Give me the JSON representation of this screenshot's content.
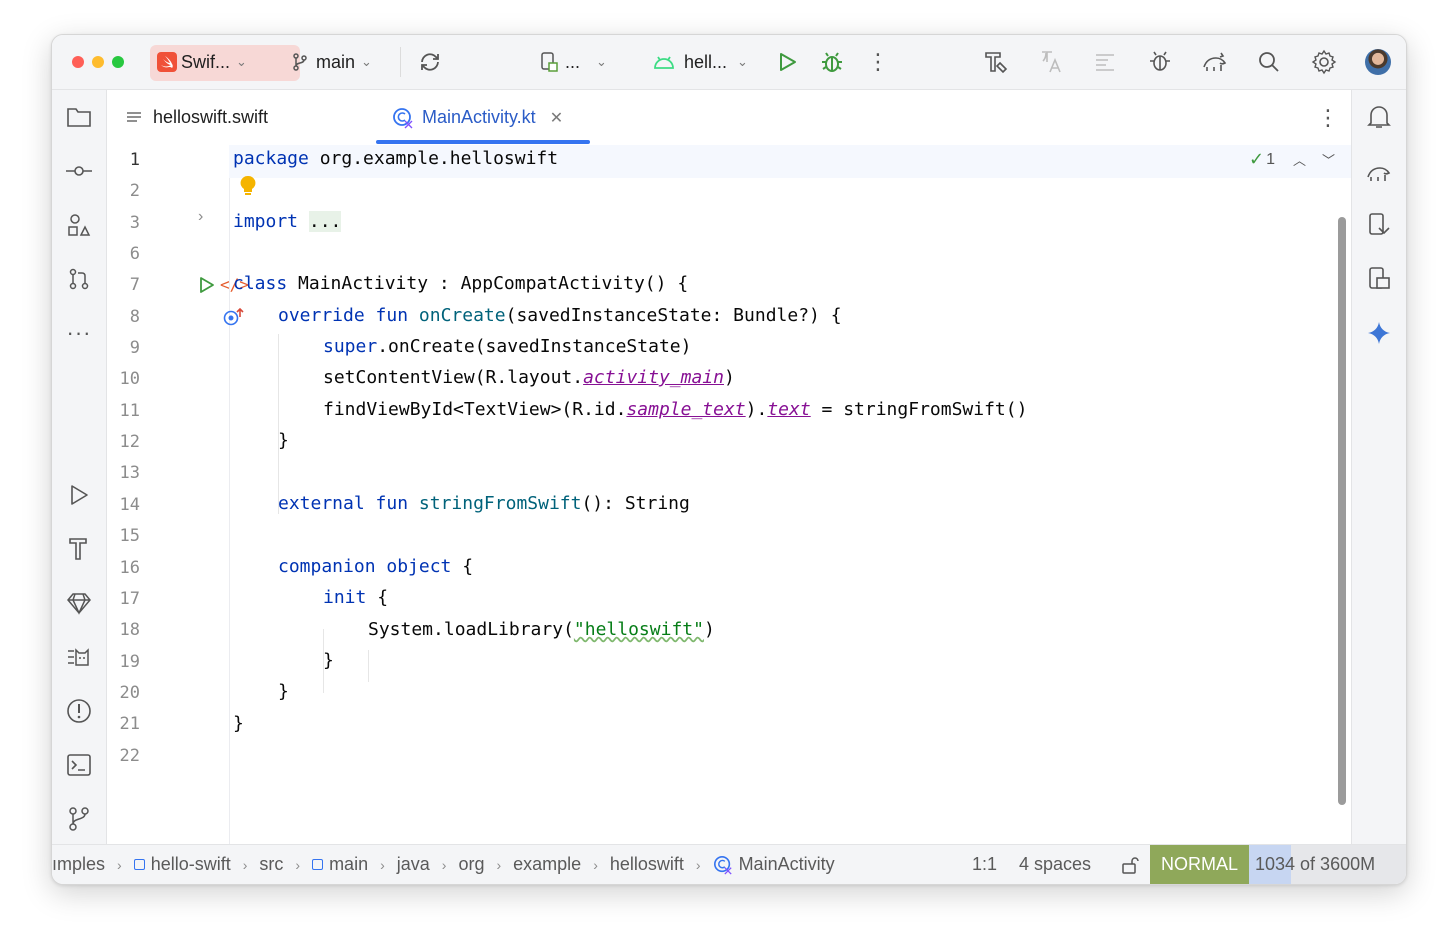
{
  "titlebar": {
    "project": "Swif...",
    "branch": "main",
    "device": "...",
    "run_config": "hell..."
  },
  "tabs": [
    {
      "label": "helloswift.swift"
    },
    {
      "label": "MainActivity.kt"
    }
  ],
  "inspection": {
    "count": "1"
  },
  "gutter": [
    "1",
    "2",
    "3",
    "6",
    "7",
    "8",
    "9",
    "10",
    "11",
    "12",
    "13",
    "14",
    "15",
    "16",
    "17",
    "18",
    "19",
    "20",
    "21",
    "22"
  ],
  "code": {
    "l1_kw": "package",
    "l1_rest": " org.example.helloswift",
    "l3_kw": "import",
    "l3_fold": "...",
    "l7_kw": "class",
    "l7_rest": " MainActivity : AppCompatActivity() {",
    "l8_kw1": "override",
    "l8_kw2": "fun",
    "l8_fn": "onCreate",
    "l8_rest": "(savedInstanceState: Bundle?) {",
    "l9_kw": "super",
    "l9_rest": ".onCreate(savedInstanceState)",
    "l10_pre": "setContentView(R.layout.",
    "l10_prop": "activity_main",
    "l10_post": ")",
    "l11_pre": "findViewById<TextView>(R.id.",
    "l11_prop1": "sample_text",
    "l11_mid": ").",
    "l11_prop2": "text",
    "l11_post": " = stringFromSwift()",
    "l12": "}",
    "l14_kw1": "external",
    "l14_kw2": "fun",
    "l14_fn": "stringFromSwift",
    "l14_rest": "(): String",
    "l16_kw": "companion object",
    "l16_rest": " {",
    "l17_kw": "init",
    "l17_rest": " {",
    "l18_pre": "System.loadLibrary(",
    "l18_str": "\"helloswift\"",
    "l18_post": ")",
    "l19": "}",
    "l20": "}",
    "l21": "}"
  },
  "breadcrumbs": [
    "ımples",
    "hello-swift",
    "src",
    "main",
    "java",
    "org",
    "example",
    "helloswift",
    "MainActivity"
  ],
  "status": {
    "position": "1:1",
    "indent": "4 spaces",
    "mode": "NORMAL",
    "memory": "1034 of 3600M"
  },
  "colors": {
    "accent": "#3574f0",
    "keyword": "#0033b3",
    "function": "#00627a",
    "property": "#871094",
    "string": "#067d17",
    "mode_badge": "#8fa85a",
    "project_chip": "#f7d8d6"
  }
}
